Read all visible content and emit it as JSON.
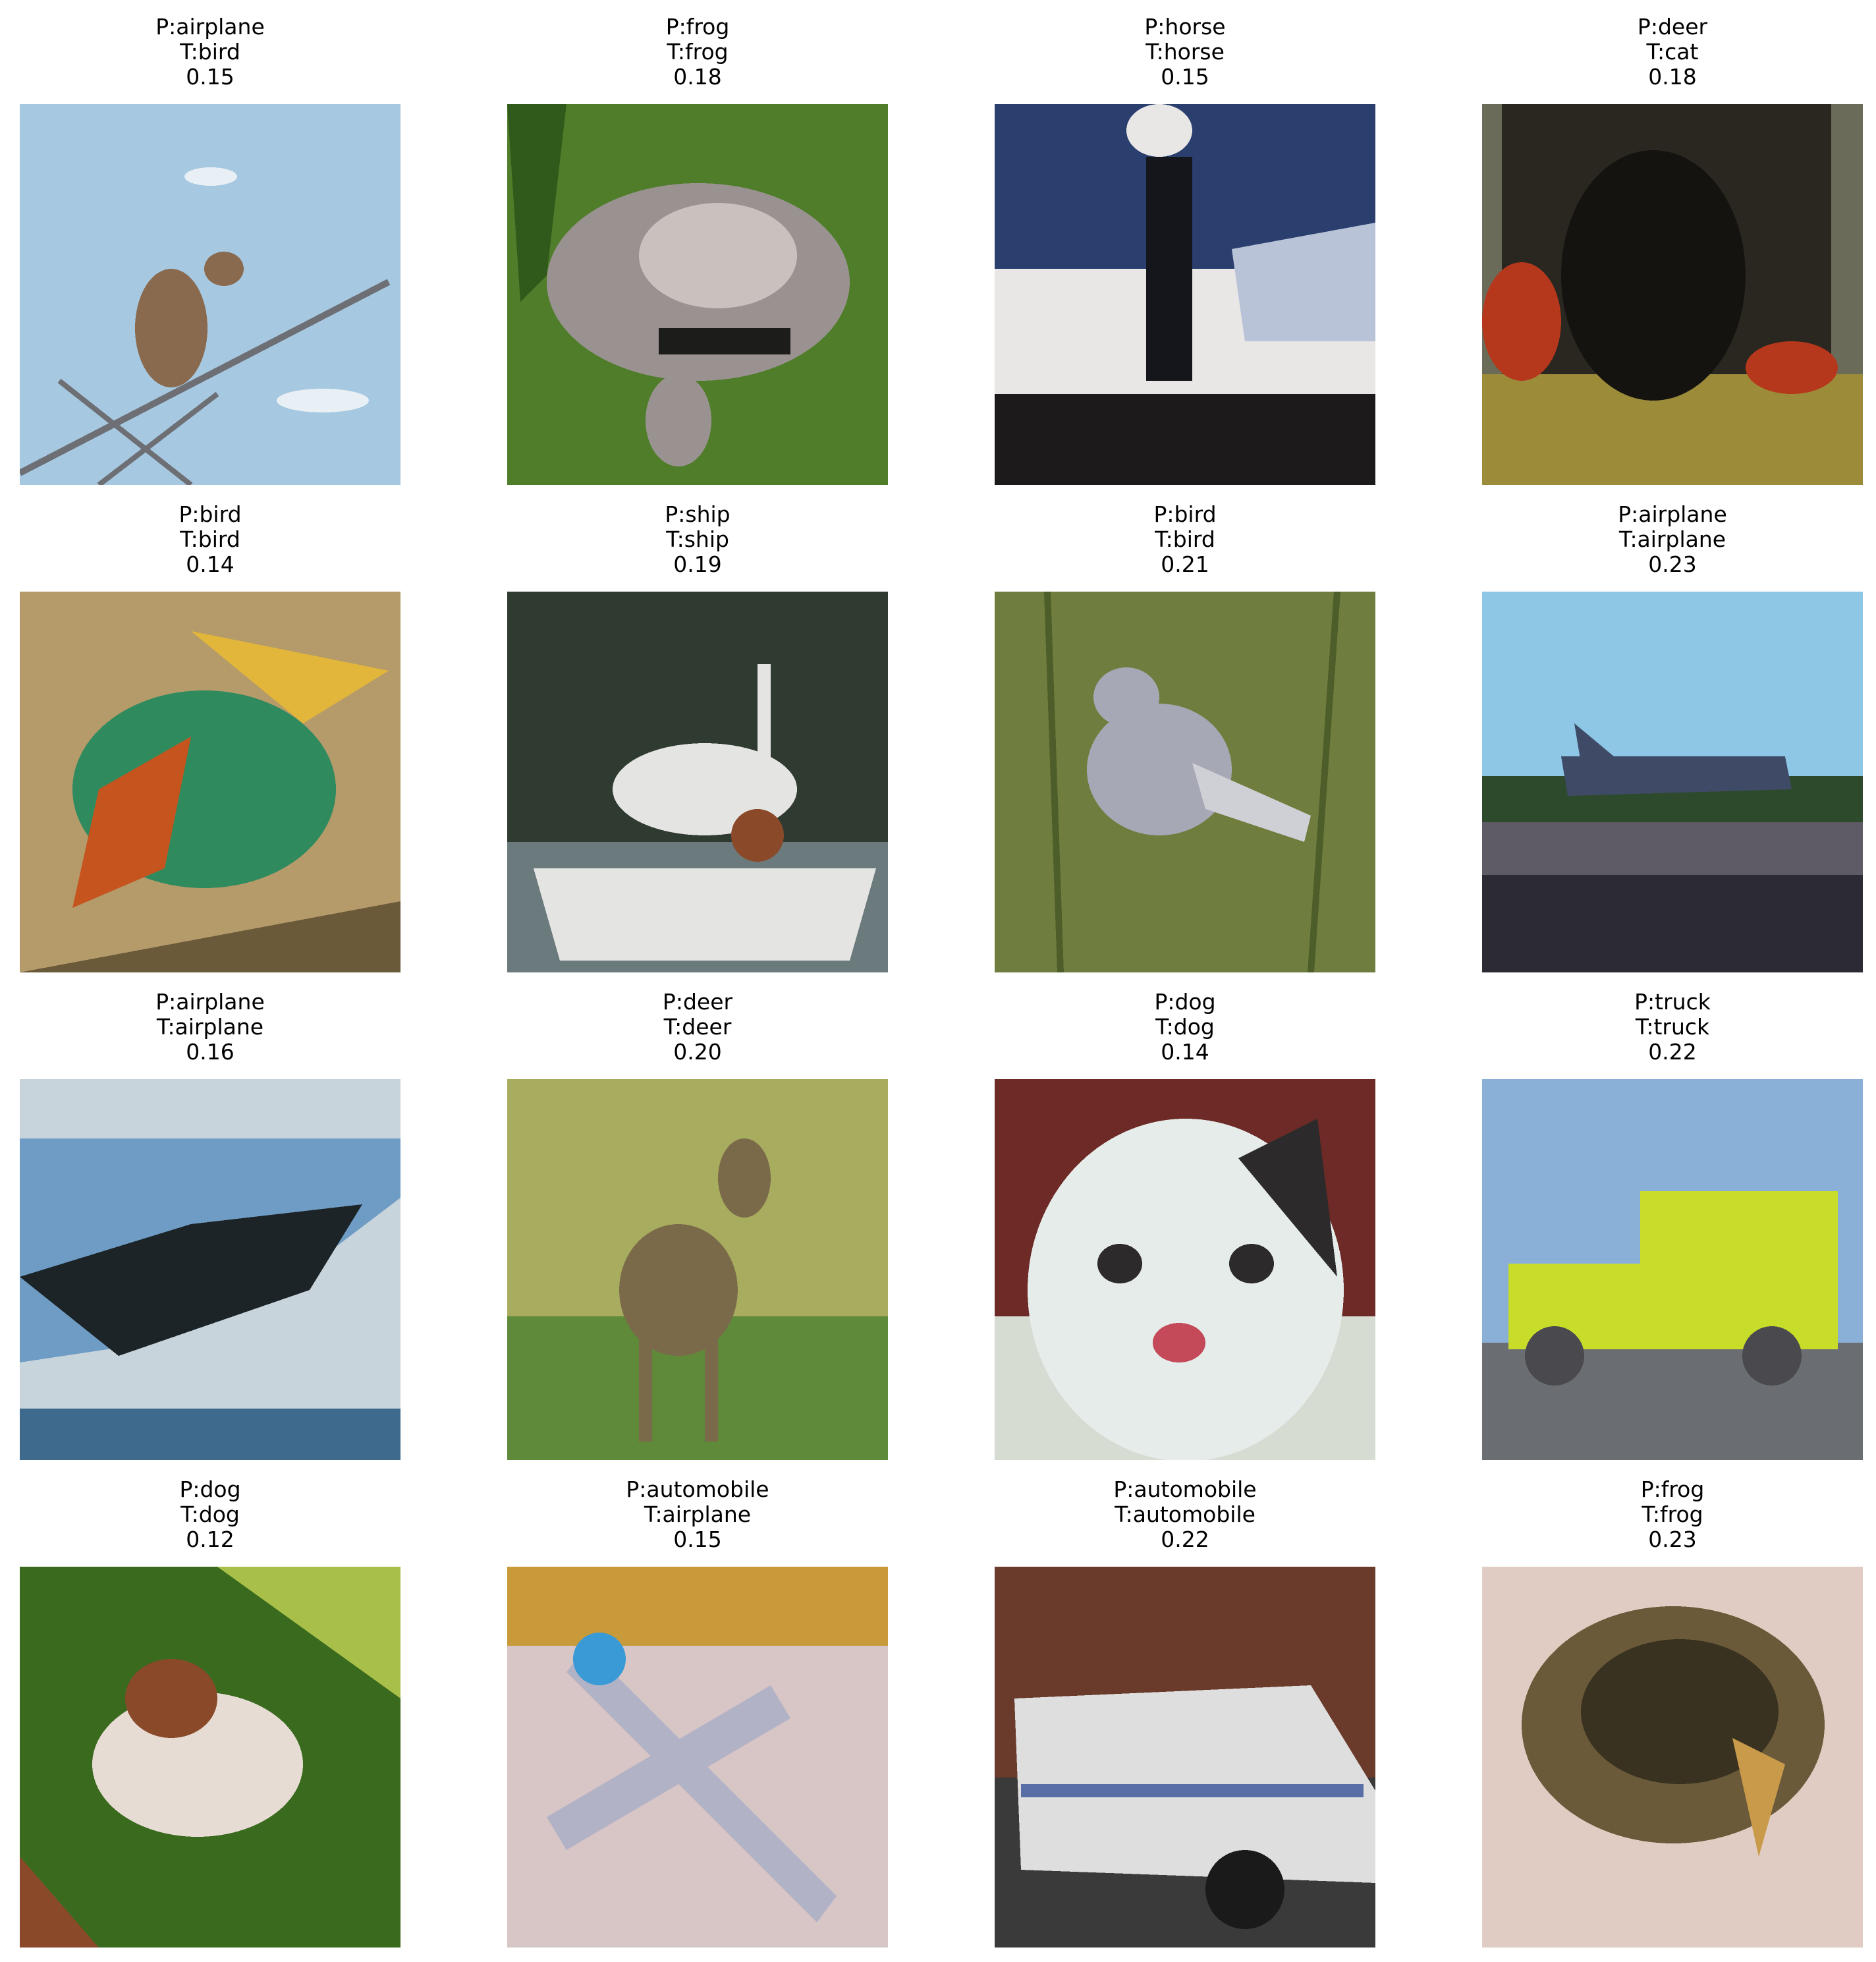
{
  "cells": [
    {
      "prediction": "P:airplane",
      "truth": "T:bird",
      "score": "0.15",
      "subject": "bird-on-branch",
      "palette": [
        "#a6c8e0",
        "#8a6a4e",
        "#6d6f74",
        "#e8f0f6"
      ]
    },
    {
      "prediction": "P:frog",
      "truth": "T:frog",
      "score": "0.18",
      "subject": "frog-on-grass",
      "palette": [
        "#4f7d2a",
        "#9a9290",
        "#2f5a1c",
        "#c9c1bd"
      ]
    },
    {
      "prediction": "P:horse",
      "truth": "T:horse",
      "score": "0.15",
      "subject": "horse-riders",
      "palette": [
        "#2a3f6e",
        "#e9e6e6",
        "#1c1a1a",
        "#b8c3d8"
      ]
    },
    {
      "prediction": "P:deer",
      "truth": "T:cat",
      "score": "0.18",
      "subject": "dark-cat",
      "palette": [
        "#2a2620",
        "#9c8c3a",
        "#b5381c",
        "#6b6b5a"
      ]
    },
    {
      "prediction": "P:bird",
      "truth": "T:bird",
      "score": "0.14",
      "subject": "bee-eater",
      "palette": [
        "#b59a6a",
        "#2f8a5e",
        "#c5541f",
        "#e2b63a"
      ]
    },
    {
      "prediction": "P:ship",
      "truth": "T:ship",
      "score": "0.19",
      "subject": "white-boat",
      "palette": [
        "#2f3a30",
        "#e4e4e2",
        "#6b7a7c",
        "#8a4a2a"
      ]
    },
    {
      "prediction": "P:bird",
      "truth": "T:bird",
      "score": "0.21",
      "subject": "grey-bird-grass",
      "palette": [
        "#6f7e3e",
        "#a6a8b6",
        "#4e5e2a",
        "#cfcfd6"
      ]
    },
    {
      "prediction": "P:airplane",
      "truth": "T:airplane",
      "score": "0.23",
      "subject": "jet-on-runway",
      "palette": [
        "#8ec7e6",
        "#2e4a2c",
        "#5e5a66",
        "#2c2a34"
      ]
    },
    {
      "prediction": "P:airplane",
      "truth": "T:airplane",
      "score": "0.16",
      "subject": "plane-over-mountains",
      "palette": [
        "#6e9cc4",
        "#1c2428",
        "#c8d4dc",
        "#3e6a8e"
      ]
    },
    {
      "prediction": "P:deer",
      "truth": "T:deer",
      "score": "0.20",
      "subject": "deer-in-field",
      "palette": [
        "#a8ac5e",
        "#7a6a4a",
        "#5e8a3a",
        "#c4c07a"
      ]
    },
    {
      "prediction": "P:dog",
      "truth": "T:dog",
      "score": "0.14",
      "subject": "chihuahua",
      "palette": [
        "#e6ecea",
        "#6e2a26",
        "#2c2a2a",
        "#c44a5a"
      ]
    },
    {
      "prediction": "P:truck",
      "truth": "T:truck",
      "score": "0.22",
      "subject": "yellow-truck",
      "palette": [
        "#c8dc2a",
        "#8ab0d8",
        "#4a4a4e",
        "#6a6e72"
      ]
    },
    {
      "prediction": "P:dog",
      "truth": "T:dog",
      "score": "0.12",
      "subject": "puppy-on-grass",
      "palette": [
        "#3a6a1e",
        "#e6dcd4",
        "#8a4a2a",
        "#a8c04a"
      ]
    },
    {
      "prediction": "P:automobile",
      "truth": "T:airplane",
      "score": "0.15",
      "subject": "toy-airplane",
      "palette": [
        "#d8c6c6",
        "#c89a3a",
        "#3a9ad6",
        "#b2b2c6"
      ]
    },
    {
      "prediction": "P:automobile",
      "truth": "T:automobile",
      "score": "0.22",
      "subject": "police-car",
      "palette": [
        "#6a3a2a",
        "#dedede",
        "#3a3a3a",
        "#5a6ea6"
      ]
    },
    {
      "prediction": "P:frog",
      "truth": "T:frog",
      "score": "0.23",
      "subject": "frog-on-sand",
      "palette": [
        "#e0ccc2",
        "#6a5a3a",
        "#3a3220",
        "#c89a4a"
      ]
    }
  ]
}
